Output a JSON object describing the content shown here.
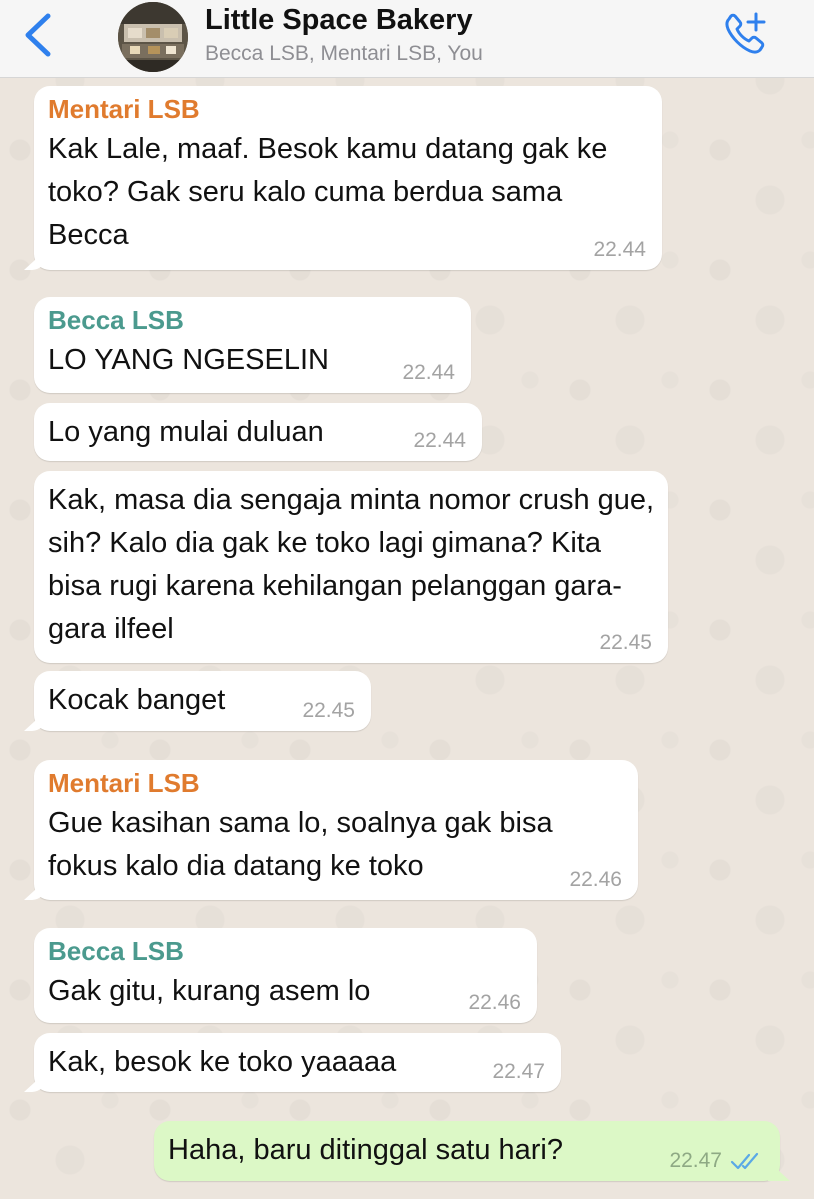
{
  "header": {
    "title": "Little Space Bakery",
    "subtitle": "Becca LSB, Mentari LSB, You",
    "back_icon": "chevron-left-icon",
    "call_icon": "phone-plus-icon",
    "accent_color": "#2f80ed"
  },
  "messages": [
    {
      "sender": "Mentari LSB",
      "text": "Kak Lale, maaf. Besok kamu datang gak ke toko? Gak seru kalo cuma berdua sama Becca",
      "time": "22.44",
      "direction": "incoming"
    },
    {
      "sender": "Becca LSB",
      "text": "LO YANG NGESELIN",
      "time": "22.44",
      "direction": "incoming"
    },
    {
      "sender": "",
      "text": "Lo yang mulai duluan",
      "time": "22.44",
      "direction": "incoming"
    },
    {
      "sender": "",
      "text": "Kak, masa dia sengaja minta nomor crush gue, sih? Kalo dia gak ke toko lagi gimana? Kita bisa rugi karena kehilangan pelanggan gara-gara ilfeel",
      "time": "22.45",
      "direction": "incoming"
    },
    {
      "sender": "",
      "text": "Kocak banget",
      "time": "22.45",
      "direction": "incoming"
    },
    {
      "sender": "Mentari LSB",
      "text": "Gue kasihan sama lo, soalnya gak bisa fokus kalo dia datang ke toko",
      "time": "22.46",
      "direction": "incoming"
    },
    {
      "sender": "Becca LSB",
      "text": "Gak gitu, kurang asem lo",
      "time": "22.46",
      "direction": "incoming"
    },
    {
      "sender": "",
      "text": "Kak, besok ke toko yaaaaa",
      "time": "22.47",
      "direction": "incoming"
    },
    {
      "sender": "",
      "text": "Haha, baru ditinggal satu hari?",
      "time": "22.47",
      "direction": "outgoing",
      "status_icon": "double-check-read-icon"
    }
  ],
  "colors": {
    "mentari": "#e07b2e",
    "becca": "#4b9a8e",
    "outgoing_bubble": "#dcf8c6",
    "incoming_bubble": "#ffffff",
    "read_ticks": "#5aa9e6"
  }
}
